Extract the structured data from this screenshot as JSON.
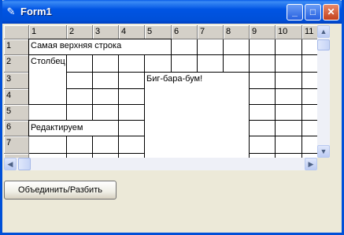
{
  "window": {
    "title": "Form1",
    "app_icon": "delphi-form-icon"
  },
  "titlebar_buttons": {
    "minimize": "minimize-icon",
    "maximize": "maximize-icon",
    "close": "close-icon"
  },
  "grid": {
    "col_headers": [
      "",
      "1",
      "2",
      "3",
      "4",
      "5",
      "6",
      "7",
      "8",
      "9",
      "10",
      "11"
    ],
    "row_headers": [
      "",
      "1",
      "2",
      "3",
      "4",
      "5",
      "6",
      "7"
    ],
    "merged_cells": [
      {
        "name": "merged-cell-top-row",
        "text": "Самая верхняя строка",
        "r1": 1,
        "c1": 1,
        "r2": 1,
        "c2": 5
      },
      {
        "name": "merged-cell-column",
        "text": "Столбец",
        "r1": 2,
        "c1": 1,
        "r2": 4,
        "c2": 1
      },
      {
        "name": "merged-cell-big",
        "text": "Биг-бара-бум!",
        "r1": 3,
        "c1": 5,
        "r2": 8,
        "c2": 8
      }
    ],
    "editor": {
      "value": "Редактируем",
      "r1": 6,
      "c1": 1,
      "c2": 3
    }
  },
  "actions": {
    "merge_split_label": "Объединить/Разбить"
  }
}
